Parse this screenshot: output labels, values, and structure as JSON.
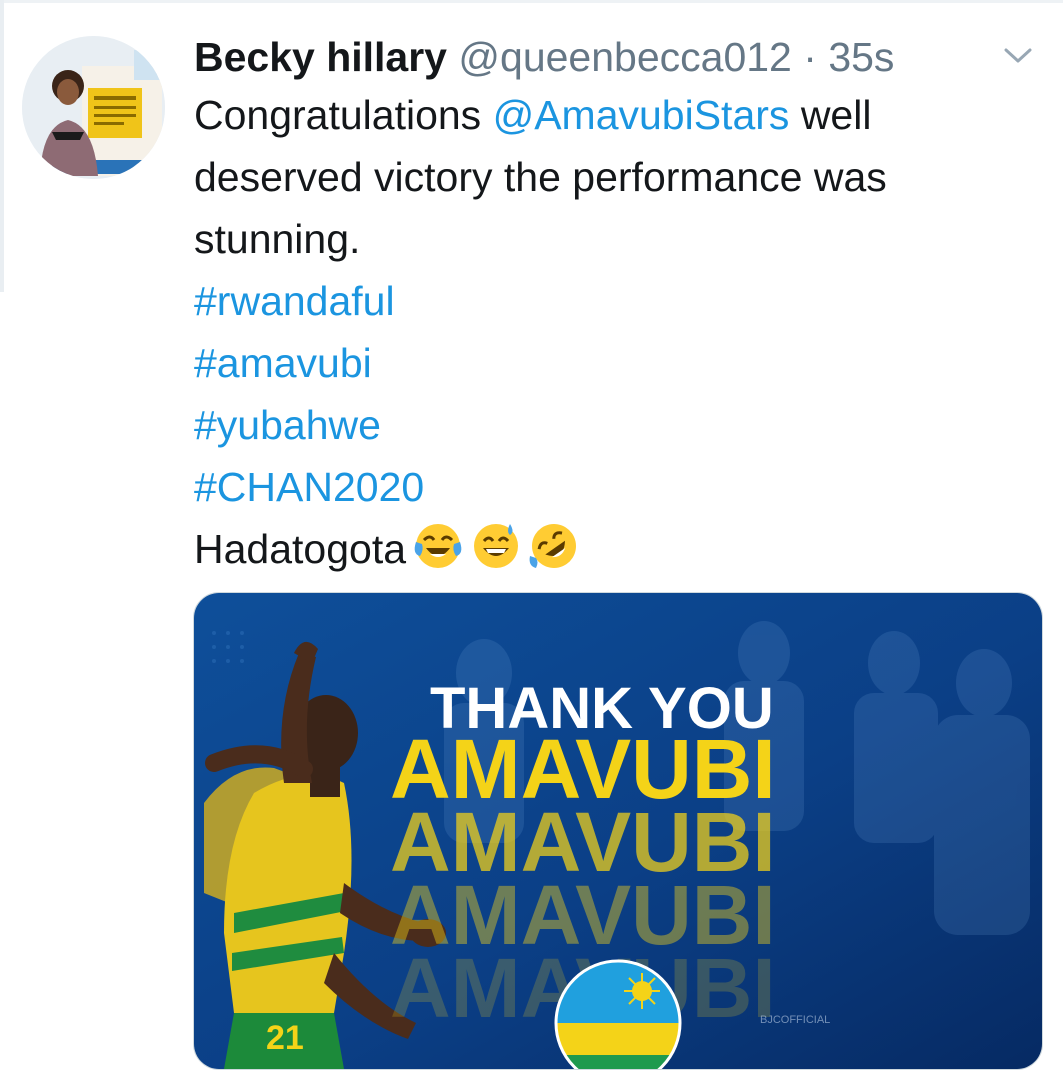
{
  "tweet": {
    "author": {
      "display_name": "Becky hillary",
      "handle": "@queenbecca012",
      "separator": "·",
      "time": "35s"
    },
    "text": {
      "line1_prefix": "Congratulations ",
      "mention": "@AmavubiStars",
      "line1_suffix": " well",
      "line2": "deserved victory the performance was",
      "line3": "stunning.",
      "hashtags": [
        "#rwandaful",
        "#amavubi",
        "#yubahwe",
        "#CHAN2020"
      ],
      "closing_word": "Hadatogota"
    },
    "emojis": [
      "tears-of-joy-emoji",
      "grinning-sweat-emoji",
      "rofl-emoji"
    ],
    "media": {
      "headline": "THANK YOU",
      "repeated_word": "AMAVUBI",
      "jersey_number": "21",
      "watermark": "BJCOFFICIAL"
    }
  },
  "colors": {
    "link": "#1b95e0",
    "secondary_text": "#657786",
    "banner_blue": "#0b3f86",
    "banner_yellow": "#f4d318",
    "flag_green": "#1f9a4e"
  }
}
